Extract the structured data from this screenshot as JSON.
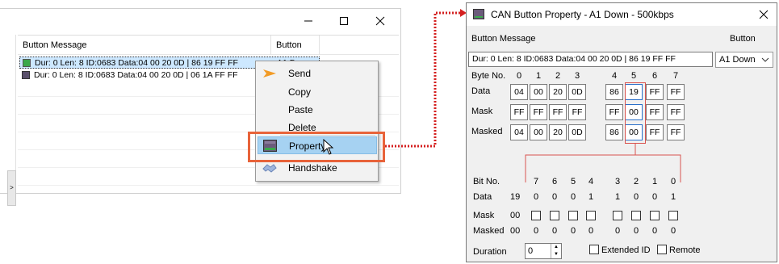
{
  "left_window": {
    "header": {
      "col_message": "Button Message",
      "col_button": "Button"
    },
    "rows": [
      {
        "text": "Dur:  0 Len: 8 ID:0683 Data:04 00 20 0D | 86 19 FF FF",
        "button": "A1 Down"
      },
      {
        "text": "Dur:  0 Len: 8 ID:0683 Data:04 00 20 0D | 06 1A FF FF",
        "button": ""
      }
    ],
    "context_menu": {
      "items": [
        {
          "label": "Send",
          "icon": "send-arrow-icon"
        },
        {
          "label": "Copy",
          "icon": ""
        },
        {
          "label": "Paste",
          "icon": ""
        },
        {
          "label": "Delete",
          "icon": ""
        },
        {
          "label": "Property",
          "icon": "property-icon"
        },
        {
          "label": "Handshake",
          "icon": "handshake-icon"
        }
      ]
    }
  },
  "dialog": {
    "title": "CAN Button Property - A1 Down - 500kbps",
    "label_button_message": "Button Message",
    "label_button": "Button",
    "message_value": "Dur:  0 Len: 8 ID:0683 Data:04 00 20 0D | 86 19 FF FF",
    "button_value": "A1 Down",
    "byte_no_label": "Byte  No.",
    "byte_numbers": [
      "0",
      "1",
      "2",
      "3",
      "4",
      "5",
      "6",
      "7"
    ],
    "row_labels": {
      "data": "Data",
      "mask": "Mask",
      "masked": "Masked"
    },
    "data_bytes": [
      "04",
      "00",
      "20",
      "0D",
      "86",
      "19",
      "FF",
      "FF"
    ],
    "mask_bytes": [
      "FF",
      "FF",
      "FF",
      "FF",
      "FF",
      "00",
      "FF",
      "FF"
    ],
    "masked_bytes": [
      "04",
      "00",
      "20",
      "0D",
      "86",
      "00",
      "FF",
      "FF"
    ],
    "bit_section": {
      "bit_no_label": "Bit No.",
      "bit_numbers": [
        "7",
        "6",
        "5",
        "4",
        "3",
        "2",
        "1",
        "0"
      ],
      "data_label": "Data",
      "data_hex": "19",
      "data_bits": [
        "0",
        "0",
        "0",
        "1",
        "1",
        "0",
        "0",
        "1"
      ],
      "mask_label": "Mask",
      "mask_hex": "00",
      "mask_checks": [
        false,
        false,
        false,
        false,
        false,
        false,
        false,
        false
      ],
      "masked_label": "Masked",
      "masked_hex": "00",
      "masked_bits": [
        "0",
        "0",
        "0",
        "0",
        "0",
        "0",
        "0",
        "0"
      ]
    },
    "duration_label": "Duration",
    "duration_value": "0",
    "extended_id_label": "Extended ID",
    "remote_label": "Remote"
  },
  "colors": {
    "highlight_border": "#e8633a",
    "selection": "#a6d2f2",
    "red_line": "#d9534f",
    "arrow": "#d42020"
  }
}
